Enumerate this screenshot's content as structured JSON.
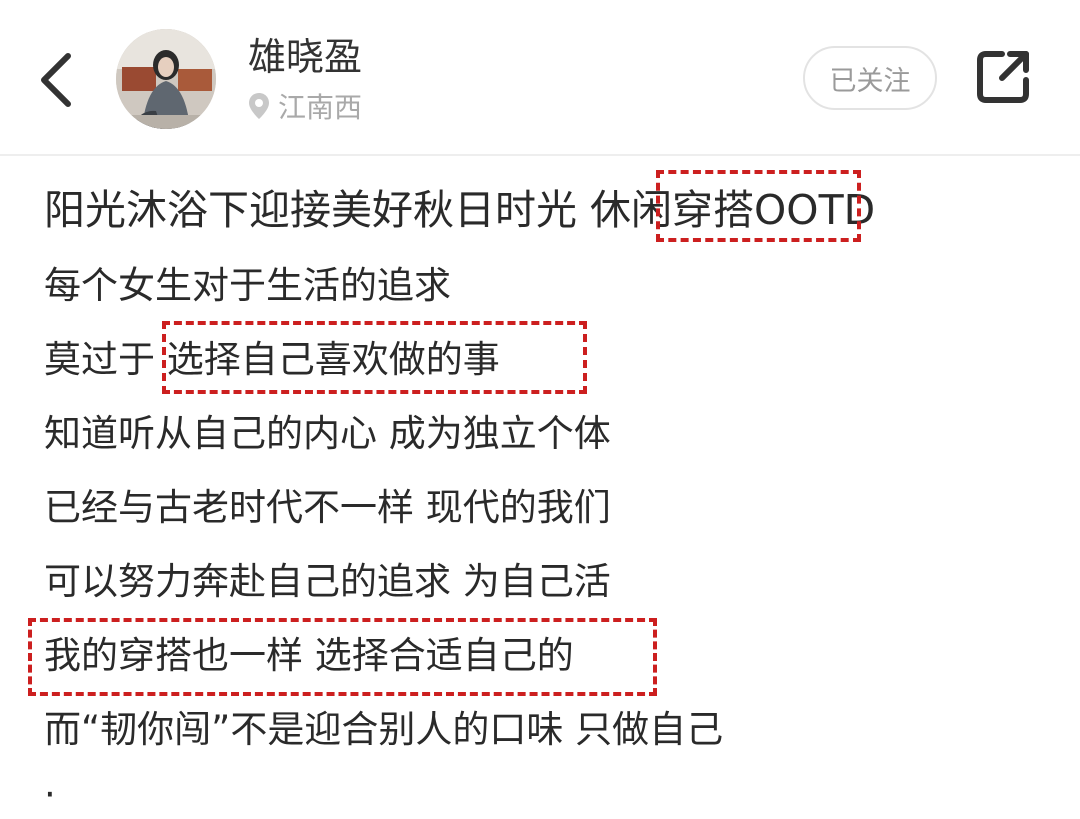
{
  "header": {
    "user_name": "雄晓盈",
    "location": "江南西",
    "follow_label": "已关注"
  },
  "post": {
    "title": "阳光沐浴下迎接美好秋日时光 休闲穿搭OOTD",
    "lines": [
      "每个女生对于生活的追求",
      "莫过于 选择自己喜欢做的事",
      "知道听从自己的内心 成为独立个体",
      "已经与古老时代不一样 现代的我们",
      "可以努力奔赴自己的追求 为自己活",
      "我的穿搭也一样 选择合适自己的",
      "而“韧你闯”不是迎合别人的口味 只做自己",
      "·"
    ]
  },
  "colors": {
    "highlight_border": "#cc1f1f",
    "text": "#2a2a2a",
    "muted_text": "#a9a9a9"
  },
  "icons": {
    "back": "chevron-left-icon",
    "location": "location-pin-icon",
    "share": "share-external-icon"
  }
}
